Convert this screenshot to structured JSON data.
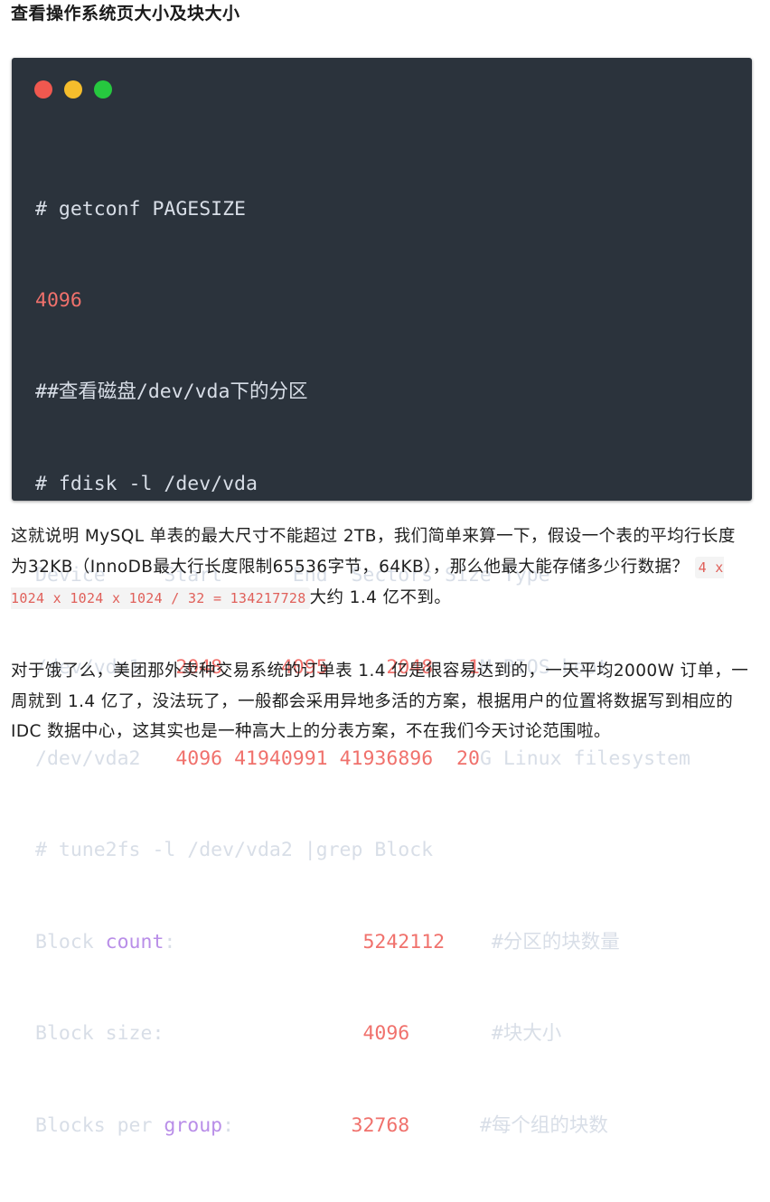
{
  "heading": "查看操作系统页大小及块大小",
  "code_window": {
    "dots": [
      "red-dot-icon",
      "yellow-dot-icon",
      "green-dot-icon"
    ],
    "lines": {
      "l1": "# getconf PAGESIZE",
      "l2": "4096",
      "l3": "##查看磁盘/dev/vda下的分区",
      "l4": "# fdisk -l /dev/vda",
      "l5": "Device     Start      End  Sectors Size Type",
      "l6": {
        "device": "/dev/vda1",
        "start": "2048",
        "end": "4095",
        "sectors": "2048",
        "size_num": "1",
        "size_unit": "M",
        "type": "BIOS boot"
      },
      "l7": {
        "device": "/dev/vda2",
        "start": "4096",
        "end": "41940991",
        "sectors": "41936896",
        "size_num": "20",
        "size_unit": "G",
        "type": "Linux filesystem"
      },
      "l8": "# tune2fs -l /dev/vda2 |grep Block",
      "l9": {
        "pre": "Block ",
        "kw": "count",
        "post": ":",
        "val": "5242112",
        "comment": "#分区的块数量"
      },
      "l10": {
        "pre": "Block size:",
        "val": "4096",
        "comment": "#块大小"
      },
      "l11": {
        "pre": "Blocks per ",
        "kw": "group",
        "post": ":",
        "val": "32768",
        "comment": "#每个组的块数"
      }
    }
  },
  "paragraph1": {
    "before": "这就说明 MySQL 单表的最大尺寸不能超过 2TB，我们简单来算一下，假设一个表的平均行长度为32KB（InnoDB最大行长度限制65536字节，64KB），那么他最大能存储多少行数据？",
    "code": "4 x 1024 x 1024 x 1024 / 32 = 134217728",
    "after": "大约 1.4 亿不到。"
  },
  "paragraph2": "对于饿了么，美团那外卖种交易系统的订单表 1.4 亿是很容易达到的，一天平均2000W 订单，一周就到 1.4 亿了，没法玩了，一般都会采用异地多活的方案，根据用户的位置将数据写到相应的 IDC 数据中心，这其实也是一种高大上的分表方案，不在我们今天讨论范围啦。"
}
